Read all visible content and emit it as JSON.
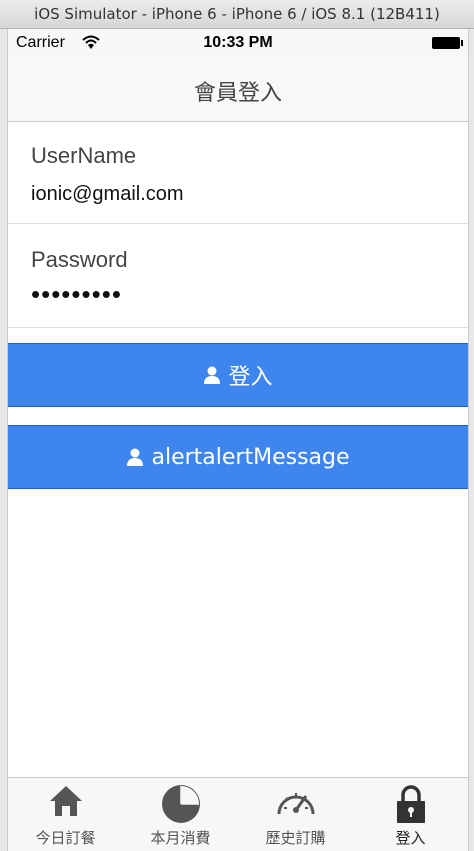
{
  "window": {
    "title": "iOS Simulator - iPhone 6 - iPhone 6 / iOS 8.1 (12B411)"
  },
  "statusbar": {
    "carrier": "Carrier",
    "time": "10:33 PM"
  },
  "navbar": {
    "title": "會員登入"
  },
  "form": {
    "username": {
      "label": "UserName",
      "value": "ionic@gmail.com"
    },
    "password": {
      "label": "Password",
      "value": "•••••••••"
    }
  },
  "buttons": {
    "login": {
      "label": "登入",
      "icon": "person-icon"
    },
    "alert": {
      "label": "alertalertMessage",
      "icon": "person-icon"
    }
  },
  "tabs": [
    {
      "label": "今日訂餐",
      "icon": "home-icon"
    },
    {
      "label": "本月消費",
      "icon": "pie-chart-icon"
    },
    {
      "label": "歷史訂購",
      "icon": "speedometer-icon"
    },
    {
      "label": "登入",
      "icon": "lock-icon"
    }
  ],
  "colors": {
    "primary": "#3e85ee",
    "primary_border": "#1e63c9",
    "navbar_bg": "#f8f8f8"
  }
}
